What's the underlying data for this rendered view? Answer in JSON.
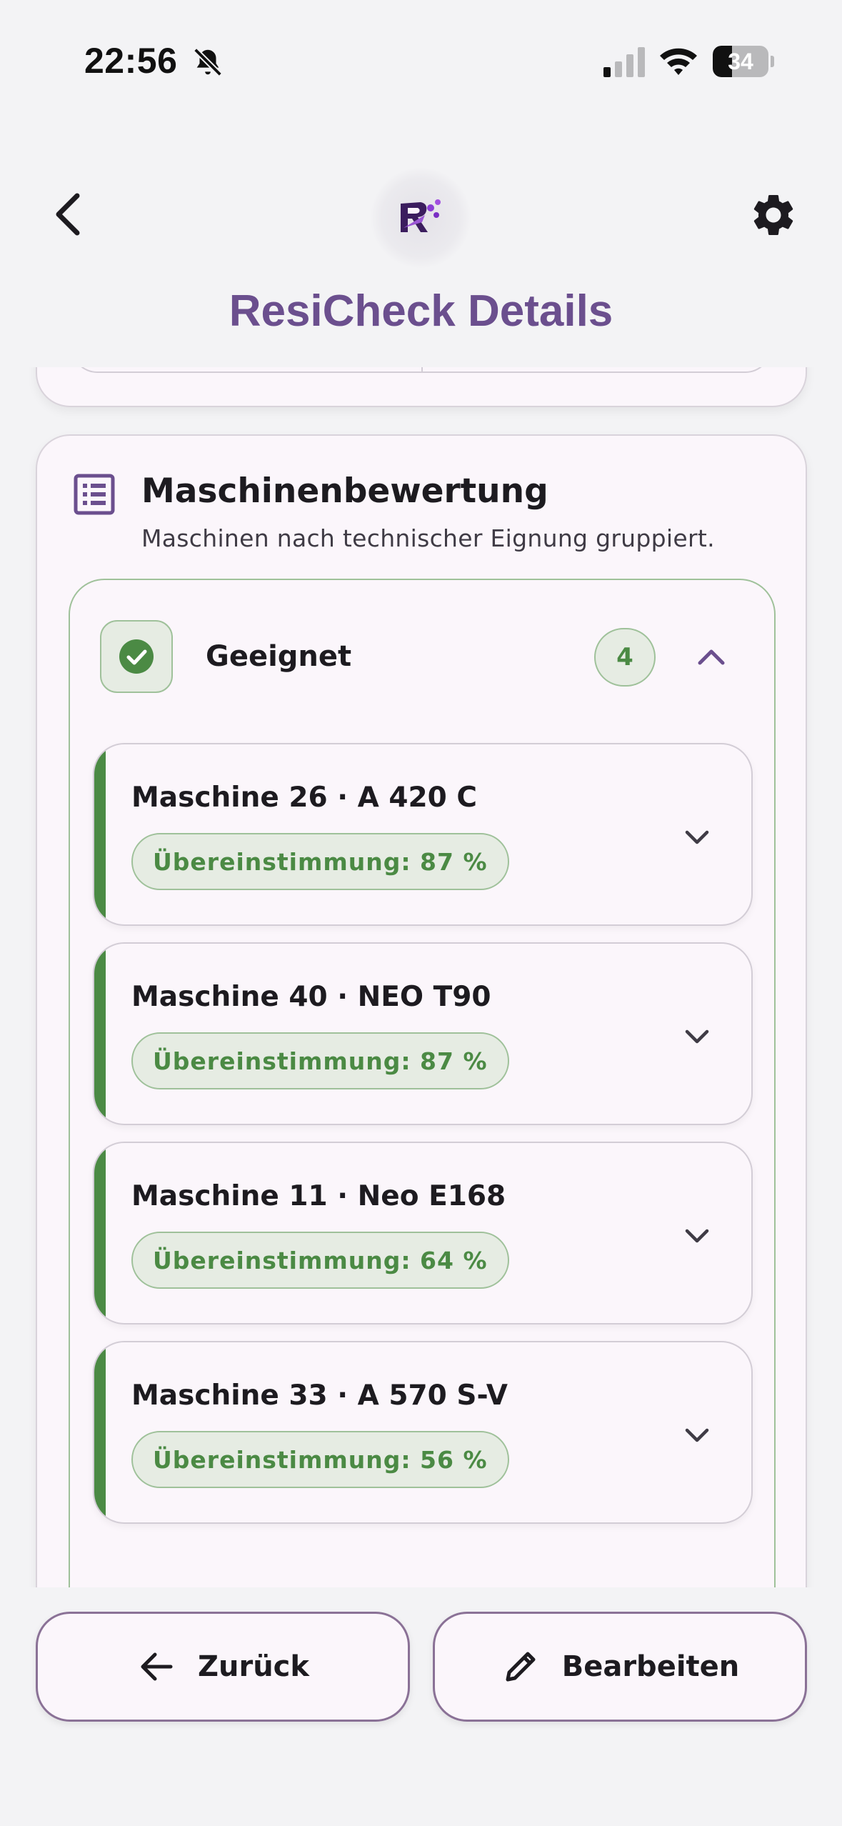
{
  "status_bar": {
    "time": "22:56",
    "battery_level": "34",
    "icons": [
      "bell-slash-icon",
      "cellular-signal-icon",
      "wifi-icon",
      "battery-icon"
    ]
  },
  "header": {
    "title": "ResiCheck Details",
    "icons": [
      "back-chevron-icon",
      "app-logo",
      "gear-icon"
    ]
  },
  "section": {
    "title": "Maschinenbewertung",
    "subtitle": "Maschinen nach technischer Eignung gruppiert.",
    "icon": "list-icon"
  },
  "group": {
    "label": "Geeignet",
    "count": "4",
    "status_icon": "check-circle-icon",
    "accent_color": "#4b8a44",
    "expanded": true
  },
  "machines": [
    {
      "title": "Maschine 26 · A 420 C",
      "match": "Übereinstimmung: 87 %"
    },
    {
      "title": "Maschine 40 · NEO T90",
      "match": "Übereinstimmung: 87 %"
    },
    {
      "title": "Maschine 11 · Neo E168",
      "match": "Übereinstimmung: 64 %"
    },
    {
      "title": "Maschine 33 · A 570 S-V",
      "match": "Übereinstimmung: 56 %"
    }
  ],
  "actions": {
    "back_label": "Zurück",
    "edit_label": "Bearbeiten"
  },
  "colors": {
    "title": "#6b4f8e",
    "card_bg": "#fbf6fb",
    "success": "#4b8a44",
    "success_bg": "#e6ece3"
  }
}
